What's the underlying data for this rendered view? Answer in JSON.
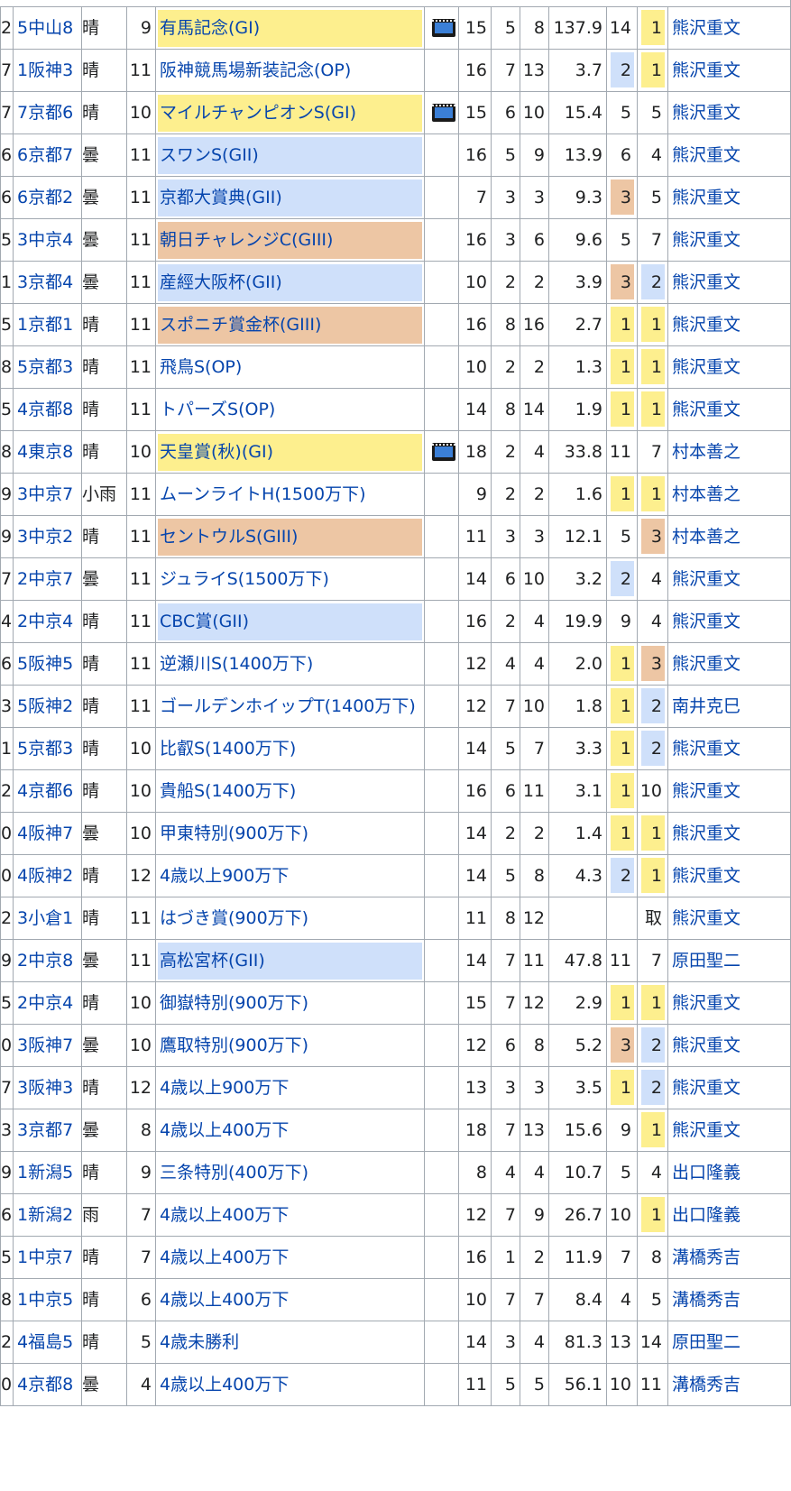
{
  "colors": {
    "G1": "#fdef8e",
    "G2": "#cfe0fa",
    "G3": "#edc6a4",
    "first": "#fdef8e",
    "second": "#cfe0fa",
    "third": "#edc6a4",
    "border": "#a2a9b1",
    "link": "#0645ad"
  },
  "rows": [
    {
      "edge": "2",
      "venue": "5中山8",
      "weather": "晴",
      "race_no": "9",
      "race": "有馬記念(GI)",
      "grade": "G1",
      "video": true,
      "field": "15",
      "gate": "5",
      "horse_no": "8",
      "odds": "137.9",
      "pop": "14",
      "pop_hl": "",
      "rank": "1",
      "rank_hl": "first",
      "jockey": "熊沢重文"
    },
    {
      "edge": "7",
      "venue": "1阪神3",
      "weather": "晴",
      "race_no": "11",
      "race": "阪神競馬場新装記念(OP)",
      "grade": "",
      "video": false,
      "field": "16",
      "gate": "7",
      "horse_no": "13",
      "odds": "3.7",
      "pop": "2",
      "pop_hl": "second",
      "rank": "1",
      "rank_hl": "first",
      "jockey": "熊沢重文"
    },
    {
      "edge": "7",
      "venue": "7京都6",
      "weather": "晴",
      "race_no": "10",
      "race": "マイルチャンピオンS(GI)",
      "grade": "G1",
      "video": true,
      "field": "15",
      "gate": "6",
      "horse_no": "10",
      "odds": "15.4",
      "pop": "5",
      "pop_hl": "",
      "rank": "5",
      "rank_hl": "",
      "jockey": "熊沢重文"
    },
    {
      "edge": "6",
      "venue": "6京都7",
      "weather": "曇",
      "race_no": "11",
      "race": "スワンS(GII)",
      "grade": "G2",
      "video": false,
      "field": "16",
      "gate": "5",
      "horse_no": "9",
      "odds": "13.9",
      "pop": "6",
      "pop_hl": "",
      "rank": "4",
      "rank_hl": "",
      "jockey": "熊沢重文"
    },
    {
      "edge": "6",
      "venue": "6京都2",
      "weather": "曇",
      "race_no": "11",
      "race": "京都大賞典(GII)",
      "grade": "G2",
      "video": false,
      "field": "7",
      "gate": "3",
      "horse_no": "3",
      "odds": "9.3",
      "pop": "3",
      "pop_hl": "third",
      "rank": "5",
      "rank_hl": "",
      "jockey": "熊沢重文"
    },
    {
      "edge": "5",
      "venue": "3中京4",
      "weather": "曇",
      "race_no": "11",
      "race": "朝日チャレンジC(GIII)",
      "grade": "G3",
      "video": false,
      "field": "16",
      "gate": "3",
      "horse_no": "6",
      "odds": "9.6",
      "pop": "5",
      "pop_hl": "",
      "rank": "7",
      "rank_hl": "",
      "jockey": "熊沢重文"
    },
    {
      "edge": "1",
      "venue": "3京都4",
      "weather": "曇",
      "race_no": "11",
      "race": "産經大阪杯(GII)",
      "grade": "G2",
      "video": false,
      "field": "10",
      "gate": "2",
      "horse_no": "2",
      "odds": "3.9",
      "pop": "3",
      "pop_hl": "third",
      "rank": "2",
      "rank_hl": "second",
      "jockey": "熊沢重文"
    },
    {
      "edge": "5",
      "venue": "1京都1",
      "weather": "晴",
      "race_no": "11",
      "race": "スポニチ賞金杯(GIII)",
      "grade": "G3",
      "video": false,
      "field": "16",
      "gate": "8",
      "horse_no": "16",
      "odds": "2.7",
      "pop": "1",
      "pop_hl": "first",
      "rank": "1",
      "rank_hl": "first",
      "jockey": "熊沢重文"
    },
    {
      "edge": "8",
      "venue": "5京都3",
      "weather": "晴",
      "race_no": "11",
      "race": "飛鳥S(OP)",
      "grade": "",
      "video": false,
      "field": "10",
      "gate": "2",
      "horse_no": "2",
      "odds": "1.3",
      "pop": "1",
      "pop_hl": "first",
      "rank": "1",
      "rank_hl": "first",
      "jockey": "熊沢重文"
    },
    {
      "edge": "5",
      "venue": "4京都8",
      "weather": "晴",
      "race_no": "11",
      "race": "トパーズS(OP)",
      "grade": "",
      "video": false,
      "field": "14",
      "gate": "8",
      "horse_no": "14",
      "odds": "1.9",
      "pop": "1",
      "pop_hl": "first",
      "rank": "1",
      "rank_hl": "first",
      "jockey": "熊沢重文"
    },
    {
      "edge": "8",
      "venue": "4東京8",
      "weather": "晴",
      "race_no": "10",
      "race": "天皇賞(秋)(GI)",
      "grade": "G1",
      "video": true,
      "field": "18",
      "gate": "2",
      "horse_no": "4",
      "odds": "33.8",
      "pop": "11",
      "pop_hl": "",
      "rank": "7",
      "rank_hl": "",
      "jockey": "村本善之"
    },
    {
      "edge": "9",
      "venue": "3中京7",
      "weather": "小雨",
      "race_no": "11",
      "race": "ムーンライトH(1500万下)",
      "grade": "",
      "video": false,
      "field": "9",
      "gate": "2",
      "horse_no": "2",
      "odds": "1.6",
      "pop": "1",
      "pop_hl": "first",
      "rank": "1",
      "rank_hl": "first",
      "jockey": "村本善之"
    },
    {
      "edge": "9",
      "venue": "3中京2",
      "weather": "晴",
      "race_no": "11",
      "race": "セントウルS(GIII)",
      "grade": "G3",
      "video": false,
      "field": "11",
      "gate": "3",
      "horse_no": "3",
      "odds": "12.1",
      "pop": "5",
      "pop_hl": "",
      "rank": "3",
      "rank_hl": "third",
      "jockey": "村本善之"
    },
    {
      "edge": "7",
      "venue": "2中京7",
      "weather": "曇",
      "race_no": "11",
      "race": "ジュライS(1500万下)",
      "grade": "",
      "video": false,
      "field": "14",
      "gate": "6",
      "horse_no": "10",
      "odds": "3.2",
      "pop": "2",
      "pop_hl": "second",
      "rank": "4",
      "rank_hl": "",
      "jockey": "熊沢重文"
    },
    {
      "edge": "4",
      "venue": "2中京4",
      "weather": "晴",
      "race_no": "11",
      "race": "CBC賞(GII)",
      "grade": "G2",
      "video": false,
      "field": "16",
      "gate": "2",
      "horse_no": "4",
      "odds": "19.9",
      "pop": "9",
      "pop_hl": "",
      "rank": "4",
      "rank_hl": "",
      "jockey": "熊沢重文"
    },
    {
      "edge": "6",
      "venue": "5阪神5",
      "weather": "晴",
      "race_no": "11",
      "race": "逆瀬川S(1400万下)",
      "grade": "",
      "video": false,
      "field": "12",
      "gate": "4",
      "horse_no": "4",
      "odds": "2.0",
      "pop": "1",
      "pop_hl": "first",
      "rank": "3",
      "rank_hl": "third",
      "jockey": "熊沢重文"
    },
    {
      "edge": "3",
      "venue": "5阪神2",
      "weather": "晴",
      "race_no": "11",
      "race": "ゴールデンホイップT(1400万下)",
      "grade": "",
      "video": false,
      "field": "12",
      "gate": "7",
      "horse_no": "10",
      "odds": "1.8",
      "pop": "1",
      "pop_hl": "first",
      "rank": "2",
      "rank_hl": "second",
      "jockey": "南井克巳"
    },
    {
      "edge": "1",
      "venue": "5京都3",
      "weather": "晴",
      "race_no": "10",
      "race": "比叡S(1400万下)",
      "grade": "",
      "video": false,
      "field": "14",
      "gate": "5",
      "horse_no": "7",
      "odds": "3.3",
      "pop": "1",
      "pop_hl": "first",
      "rank": "2",
      "rank_hl": "second",
      "jockey": "熊沢重文"
    },
    {
      "edge": "2",
      "venue": "4京都6",
      "weather": "晴",
      "race_no": "10",
      "race": "貴船S(1400万下)",
      "grade": "",
      "video": false,
      "field": "16",
      "gate": "6",
      "horse_no": "11",
      "odds": "3.1",
      "pop": "1",
      "pop_hl": "first",
      "rank": "10",
      "rank_hl": "",
      "jockey": "熊沢重文"
    },
    {
      "edge": "0",
      "venue": "4阪神7",
      "weather": "曇",
      "race_no": "10",
      "race": "甲東特別(900万下)",
      "grade": "",
      "video": false,
      "field": "14",
      "gate": "2",
      "horse_no": "2",
      "odds": "1.4",
      "pop": "1",
      "pop_hl": "first",
      "rank": "1",
      "rank_hl": "first",
      "jockey": "熊沢重文"
    },
    {
      "edge": "0",
      "venue": "4阪神2",
      "weather": "晴",
      "race_no": "12",
      "race": "4歳以上900万下",
      "grade": "",
      "video": false,
      "field": "14",
      "gate": "5",
      "horse_no": "8",
      "odds": "4.3",
      "pop": "2",
      "pop_hl": "second",
      "rank": "1",
      "rank_hl": "first",
      "jockey": "熊沢重文"
    },
    {
      "edge": "2",
      "venue": "3小倉1",
      "weather": "晴",
      "race_no": "11",
      "race": "はづき賞(900万下)",
      "grade": "",
      "video": false,
      "field": "11",
      "gate": "8",
      "horse_no": "12",
      "odds": "",
      "pop": "",
      "pop_hl": "",
      "rank": "取",
      "rank_hl": "",
      "jockey": "熊沢重文"
    },
    {
      "edge": "9",
      "venue": "2中京8",
      "weather": "曇",
      "race_no": "11",
      "race": "高松宮杯(GII)",
      "grade": "G2",
      "video": false,
      "field": "14",
      "gate": "7",
      "horse_no": "11",
      "odds": "47.8",
      "pop": "11",
      "pop_hl": "",
      "rank": "7",
      "rank_hl": "",
      "jockey": "原田聖二"
    },
    {
      "edge": "5",
      "venue": "2中京4",
      "weather": "晴",
      "race_no": "10",
      "race": "御嶽特別(900万下)",
      "grade": "",
      "video": false,
      "field": "15",
      "gate": "7",
      "horse_no": "12",
      "odds": "2.9",
      "pop": "1",
      "pop_hl": "first",
      "rank": "1",
      "rank_hl": "first",
      "jockey": "熊沢重文"
    },
    {
      "edge": "0",
      "venue": "3阪神7",
      "weather": "曇",
      "race_no": "10",
      "race": "鷹取特別(900万下)",
      "grade": "",
      "video": false,
      "field": "12",
      "gate": "6",
      "horse_no": "8",
      "odds": "5.2",
      "pop": "3",
      "pop_hl": "third",
      "rank": "2",
      "rank_hl": "second",
      "jockey": "熊沢重文"
    },
    {
      "edge": "7",
      "venue": "3阪神3",
      "weather": "晴",
      "race_no": "12",
      "race": "4歳以上900万下",
      "grade": "",
      "video": false,
      "field": "13",
      "gate": "3",
      "horse_no": "3",
      "odds": "3.5",
      "pop": "1",
      "pop_hl": "first",
      "rank": "2",
      "rank_hl": "second",
      "jockey": "熊沢重文"
    },
    {
      "edge": "3",
      "venue": "3京都7",
      "weather": "曇",
      "race_no": "8",
      "race": "4歳以上400万下",
      "grade": "",
      "video": false,
      "field": "18",
      "gate": "7",
      "horse_no": "13",
      "odds": "15.6",
      "pop": "9",
      "pop_hl": "",
      "rank": "1",
      "rank_hl": "first",
      "jockey": "熊沢重文"
    },
    {
      "edge": "9",
      "venue": "1新潟5",
      "weather": "晴",
      "race_no": "9",
      "race": "三条特別(400万下)",
      "grade": "",
      "video": false,
      "field": "8",
      "gate": "4",
      "horse_no": "4",
      "odds": "10.7",
      "pop": "5",
      "pop_hl": "",
      "rank": "4",
      "rank_hl": "",
      "jockey": "出口隆義"
    },
    {
      "edge": "6",
      "venue": "1新潟2",
      "weather": "雨",
      "race_no": "7",
      "race": "4歳以上400万下",
      "grade": "",
      "video": false,
      "field": "12",
      "gate": "7",
      "horse_no": "9",
      "odds": "26.7",
      "pop": "10",
      "pop_hl": "",
      "rank": "1",
      "rank_hl": "first",
      "jockey": "出口隆義"
    },
    {
      "edge": "5",
      "venue": "1中京7",
      "weather": "晴",
      "race_no": "7",
      "race": "4歳以上400万下",
      "grade": "",
      "video": false,
      "field": "16",
      "gate": "1",
      "horse_no": "2",
      "odds": "11.9",
      "pop": "7",
      "pop_hl": "",
      "rank": "8",
      "rank_hl": "",
      "jockey": "溝橋秀吉"
    },
    {
      "edge": "8",
      "venue": "1中京5",
      "weather": "晴",
      "race_no": "6",
      "race": "4歳以上400万下",
      "grade": "",
      "video": false,
      "field": "10",
      "gate": "7",
      "horse_no": "7",
      "odds": "8.4",
      "pop": "4",
      "pop_hl": "",
      "rank": "5",
      "rank_hl": "",
      "jockey": "溝橋秀吉"
    },
    {
      "edge": "2",
      "venue": "4福島5",
      "weather": "晴",
      "race_no": "5",
      "race": "4歳未勝利",
      "grade": "",
      "video": false,
      "field": "14",
      "gate": "3",
      "horse_no": "4",
      "odds": "81.3",
      "pop": "13",
      "pop_hl": "",
      "rank": "14",
      "rank_hl": "",
      "jockey": "原田聖二"
    },
    {
      "edge": "0",
      "venue": "4京都8",
      "weather": "曇",
      "race_no": "4",
      "race": "4歳以上400万下",
      "grade": "",
      "video": false,
      "field": "11",
      "gate": "5",
      "horse_no": "5",
      "odds": "56.1",
      "pop": "10",
      "pop_hl": "",
      "rank": "11",
      "rank_hl": "",
      "jockey": "溝橋秀吉"
    }
  ]
}
